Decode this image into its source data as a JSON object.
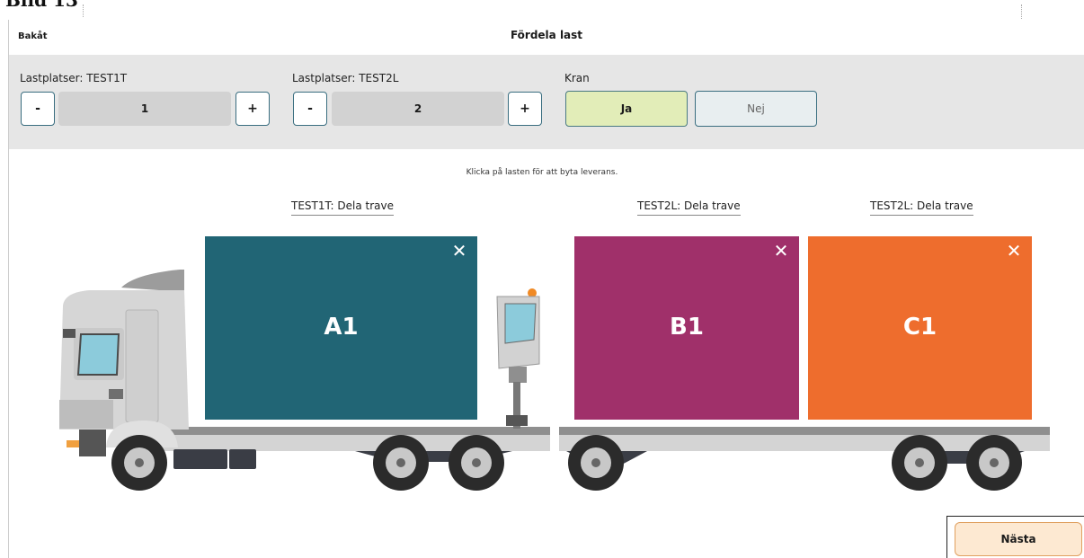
{
  "doc_heading": "Bild 13",
  "header": {
    "back_label": "Bakåt",
    "title": "Fördela last"
  },
  "controls": {
    "slot1": {
      "label": "Lastplatser: TEST1T",
      "minus": "-",
      "plus": "+",
      "value": "1"
    },
    "slot2": {
      "label": "Lastplatser: TEST2L",
      "minus": "-",
      "plus": "+",
      "value": "2"
    },
    "crane": {
      "label": "Kran",
      "yes": "Ja",
      "no": "Nej",
      "selected": "Ja"
    }
  },
  "instruction": "Klicka på lasten för att byta leverans.",
  "slots": [
    {
      "label": "TEST1T: Dela trave",
      "load": "A1",
      "color": "#216575",
      "close": "✕"
    },
    {
      "label": "TEST2L: Dela trave",
      "load": "B1",
      "color": "#a0306a",
      "close": "✕"
    },
    {
      "label": "TEST2L: Dela trave",
      "load": "C1",
      "color": "#ee6d2d",
      "close": "✕"
    }
  ],
  "footer": {
    "next_label": "Nästa"
  }
}
